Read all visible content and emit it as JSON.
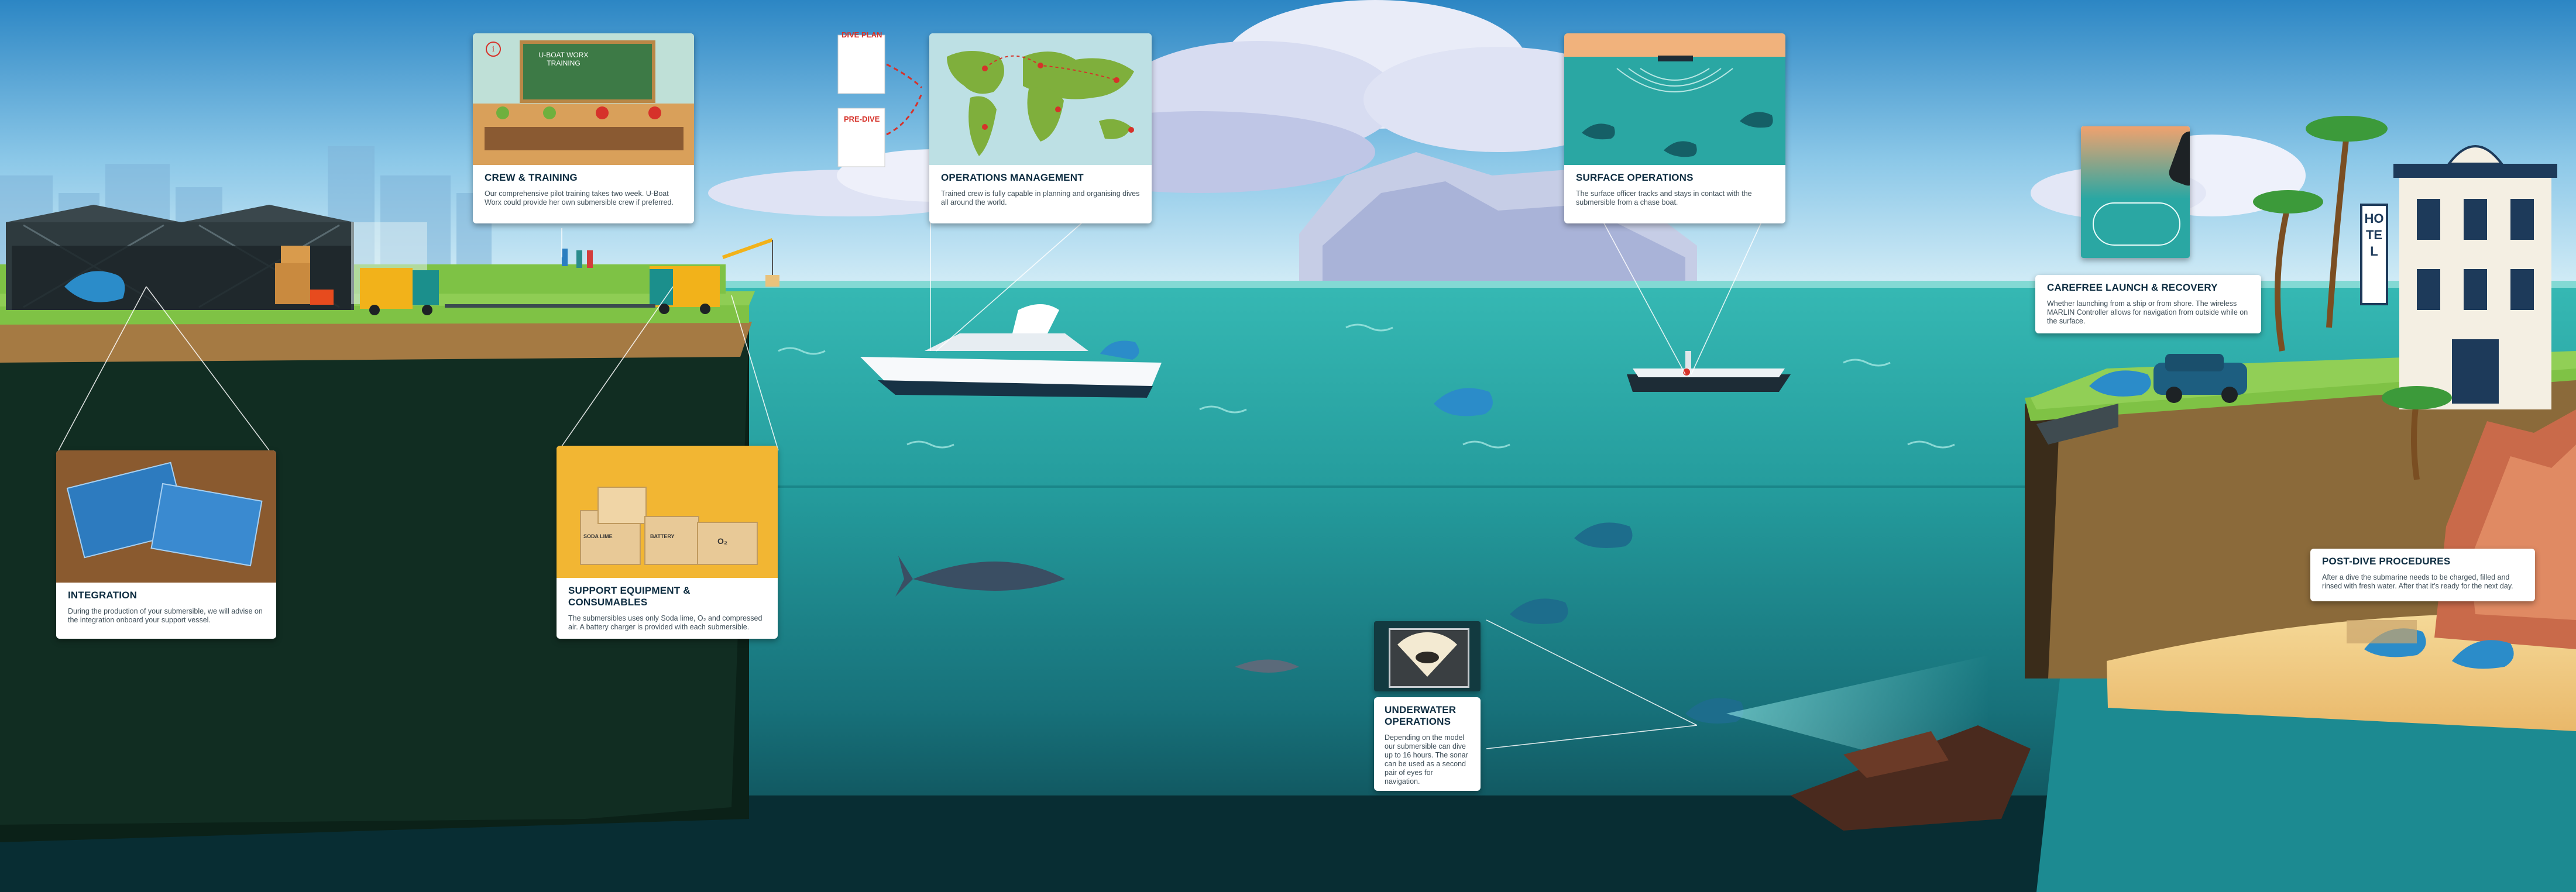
{
  "colors": {
    "sky_top": "#2f8dc9",
    "sky_bottom": "#bfe3f3",
    "sea_surface": "#2fb2b0",
    "sea_mid": "#1e8a8d",
    "sea_deep": "#0f5059",
    "cliff_dark": "#0b1f17",
    "grass": "#7fc245",
    "accent_blue": "#2b8cc9",
    "title_navy": "#0d2c40",
    "sand": "#f2cf8a"
  },
  "cards": {
    "crew_training": {
      "title": "CREW & TRAINING",
      "body": "Our comprehensive pilot training takes two week. U-Boat Worx could provide her own submersible crew if preferred.",
      "board_text": "U-BOAT WORX TRAINING"
    },
    "operations_management": {
      "title": "OPERATIONS MANAGEMENT",
      "body": "Trained crew is fully capable in planning and organising dives all around the world."
    },
    "surface_operations": {
      "title": "SURFACE OPERATIONS",
      "body": "The surface officer tracks and stays in contact with the submersible from a chase boat."
    },
    "carefree_launch": {
      "title": "CAREFREE LAUNCH & RECOVERY",
      "body": "Whether launching from a ship or from shore. The wireless MARLIN Controller allows for navigation from outside while on the surface."
    },
    "integration": {
      "title": "INTEGRATION",
      "body": "During the production of your submersible, we will advise on the integration onboard your support vessel."
    },
    "support_equipment": {
      "title": "SUPPORT EQUIPMENT & CONSUMABLES",
      "body": "The submersibles uses only Soda lime, O₂ and compressed air. A battery charger is provided with each submersible.",
      "box_labels": [
        "SODA LIME",
        "O₂",
        "BATTERY"
      ]
    },
    "underwater_operations": {
      "title": "UNDERWATER OPERATIONS",
      "body": "Depending on the model our submersible can dive up to 16 hours. The sonar can be used as a second pair of eyes for navigation."
    },
    "post_dive": {
      "title": "POST-DIVE PROCEDURES",
      "body": "After a dive the submarine needs to be charged, filled and rinsed with fresh water. After that it's ready for the next day."
    }
  },
  "docs": {
    "dive_plan": "DIVE PLAN",
    "pre_dive": "PRE-DIVE"
  },
  "hotel": {
    "sign": "HOTEL"
  }
}
